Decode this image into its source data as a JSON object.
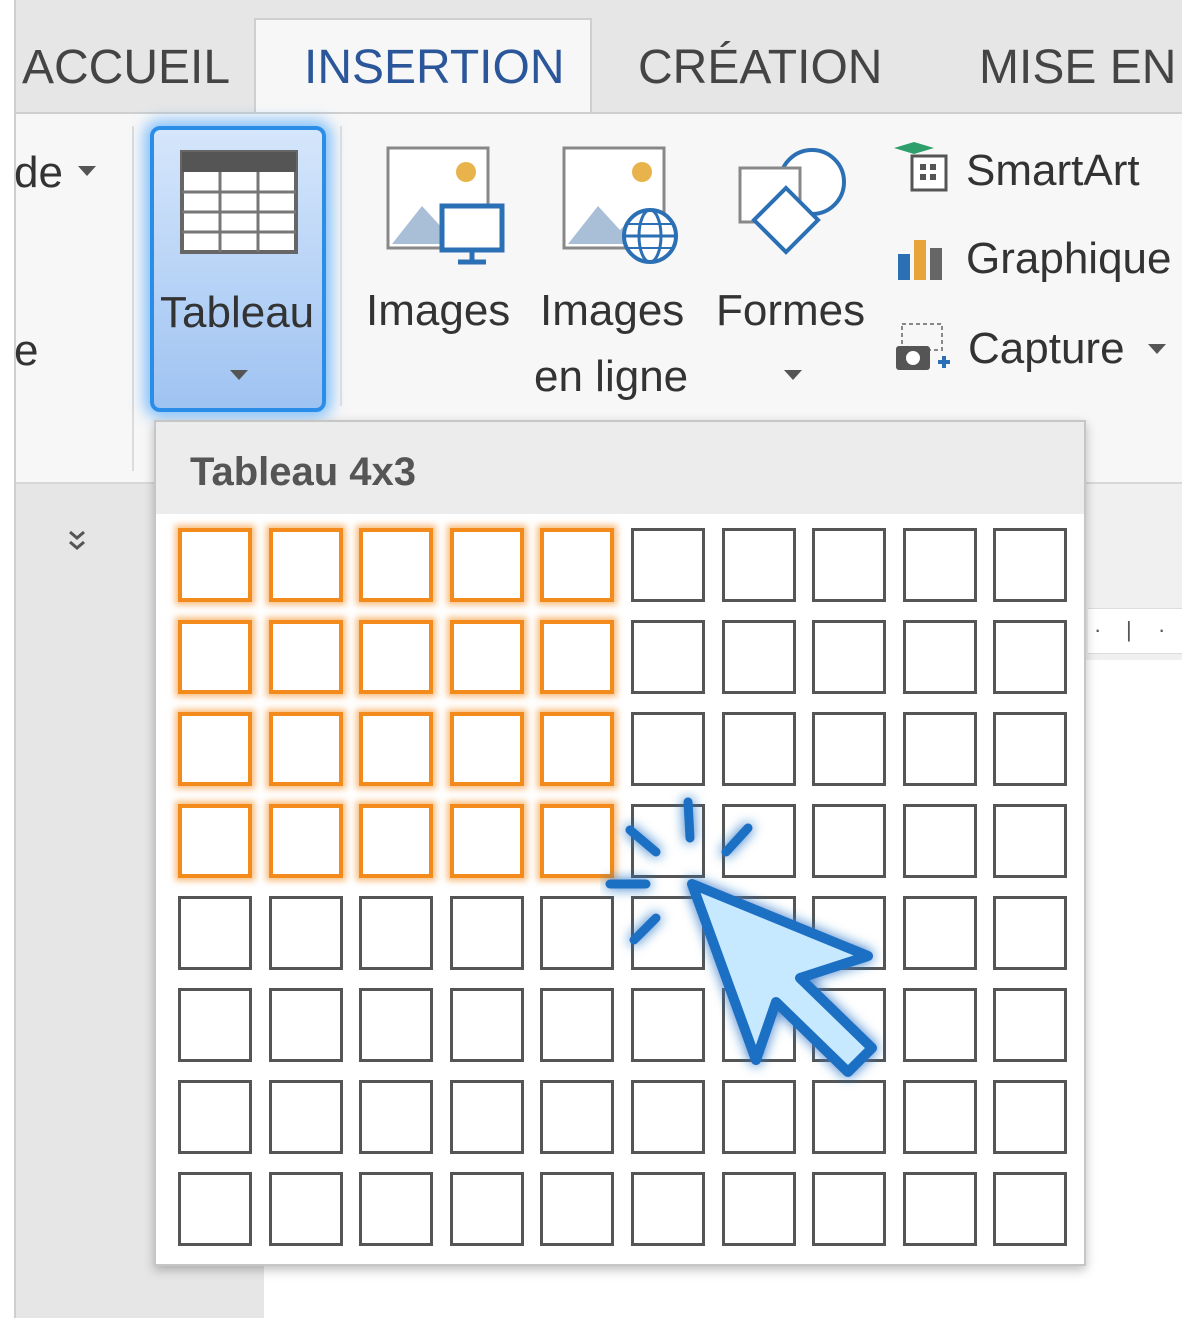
{
  "tabs": {
    "accueil": "ACCUEIL",
    "insertion": "INSERTION",
    "creation": "CRÉATION",
    "mise_en_page": "MISE EN P"
  },
  "ribbon": {
    "partial_left_top": "de",
    "partial_left_bottom": "e",
    "tableau": "Tableau",
    "images": "Images",
    "images_en_ligne_1": "Images",
    "images_en_ligne_2": "en ligne",
    "formes": "Formes",
    "smartart": "SmartArt",
    "graphique": "Graphique",
    "capture": "Capture"
  },
  "table_picker": {
    "title": "Tableau 4x3",
    "columns": 10,
    "rows": 8,
    "selected_columns": 5,
    "selected_rows": 4
  },
  "icons": [
    "table-icon",
    "images-icon",
    "online-images-icon",
    "shapes-icon",
    "smartart-icon",
    "chart-icon",
    "screenshot-icon",
    "mouse-cursor-icon"
  ],
  "colors": {
    "accent_blue": "#2b579a",
    "highlight_blue": "#2a8ee8",
    "selection_orange": "#f28a1c"
  }
}
